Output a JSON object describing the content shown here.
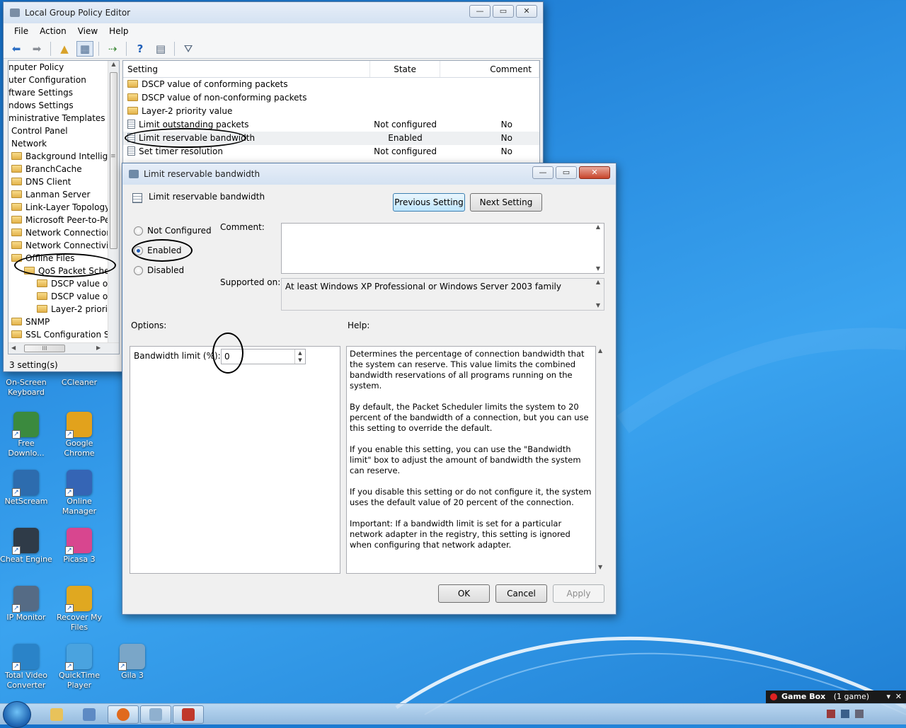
{
  "gpe": {
    "title": "Local Group Policy Editor",
    "menu": [
      "File",
      "Action",
      "View",
      "Help"
    ],
    "tree": [
      "nputer Policy",
      "uter Configuration",
      "ftware Settings",
      "ndows Settings",
      "ministrative Templates",
      "Control Panel",
      "Network",
      "Background Intelliger",
      "BranchCache",
      "DNS Client",
      "Lanman Server",
      "Link-Layer Topology",
      "Microsoft Peer-to-Pee",
      "Network Connections",
      "Network Connectivity",
      "Offline Files",
      "QoS Packet Scheduler",
      "DSCP value of cor",
      "DSCP value of nor",
      "Layer-2 priority va",
      "SNMP",
      "SSL Configuration Set"
    ],
    "columns": {
      "setting": "Setting",
      "state": "State",
      "comment": "Comment"
    },
    "rows": [
      {
        "setting": "DSCP value of conforming packets",
        "state": "",
        "comment": "",
        "kind": "folder"
      },
      {
        "setting": "DSCP value of non-conforming packets",
        "state": "",
        "comment": "",
        "kind": "folder"
      },
      {
        "setting": "Layer-2 priority value",
        "state": "",
        "comment": "",
        "kind": "folder"
      },
      {
        "setting": "Limit outstanding packets",
        "state": "Not configured",
        "comment": "No",
        "kind": "policy"
      },
      {
        "setting": "Limit reservable bandwidth",
        "state": "Enabled",
        "comment": "No",
        "kind": "policy"
      },
      {
        "setting": "Set timer resolution",
        "state": "Not configured",
        "comment": "No",
        "kind": "policy"
      }
    ],
    "status": "3 setting(s)",
    "tree_scroll_thumb": "III"
  },
  "dialog": {
    "title": "Limit reservable bandwidth",
    "heading": "Limit reservable bandwidth",
    "prev_button": "Previous Setting",
    "next_button": "Next Setting",
    "radio_not_configured": "Not Configured",
    "radio_enabled": "Enabled",
    "radio_disabled": "Disabled",
    "selected": "Enabled",
    "comment_label": "Comment:",
    "comment_value": "",
    "supported_label": "Supported on:",
    "supported_value": "At least Windows XP Professional or Windows Server 2003 family",
    "options_label": "Options:",
    "help_label": "Help:",
    "bandwidth_label": "Bandwidth limit (%):",
    "bandwidth_value": "0",
    "help_paragraphs": [
      "Determines the percentage of connection bandwidth that the system can reserve. This value limits the combined bandwidth reservations of all programs running on the system.",
      "By default, the Packet Scheduler limits the system to 20 percent of the bandwidth of a connection, but you can use this setting to override the default.",
      "If you enable this setting, you can use the \"Bandwidth limit\" box to adjust the amount of bandwidth the system can reserve.",
      "If you disable this setting or do not configure it, the system uses the default value of 20 percent of the connection.",
      "Important: If a bandwidth limit is set for a particular network adapter in the registry, this setting is ignored when configuring that network adapter."
    ],
    "ok": "OK",
    "cancel": "Cancel",
    "apply": "Apply"
  },
  "desktop_icons": [
    {
      "label": "On-Screen Keyboard",
      "icon": "keyboard-icon",
      "color": "#4a7fc0"
    },
    {
      "label": "CCleaner",
      "icon": "ccleaner-icon",
      "color": "#c0392b"
    },
    {
      "label": "Free Downlo...",
      "icon": "download-icon",
      "color": "#3b8a3e"
    },
    {
      "label": "Google Chrome",
      "icon": "chrome-icon",
      "color": "#e2a21c"
    },
    {
      "label": "NetScream",
      "icon": "netscream-icon",
      "color": "#2d6cae"
    },
    {
      "label": "Online Manager",
      "icon": "online-manager-icon",
      "color": "#3565b5"
    },
    {
      "label": "Cheat Engine",
      "icon": "cheat-engine-icon",
      "color": "#2f3b48"
    },
    {
      "label": "Picasa 3",
      "icon": "picasa-icon",
      "color": "#d8468f"
    },
    {
      "label": "IP Monitor",
      "icon": "ip-monitor-icon",
      "color": "#556b85"
    },
    {
      "label": "Recover My Files",
      "icon": "recover-icon",
      "color": "#e0a820"
    },
    {
      "label": "Total Video Converter",
      "icon": "video-converter-icon",
      "color": "#2a83c8"
    },
    {
      "label": "QuickTime Player",
      "icon": "quicktime-icon",
      "color": "#4aa3df"
    },
    {
      "label": "Gila 3",
      "icon": "image-icon",
      "color": "#7aa6c8"
    }
  ],
  "gamebox": {
    "title": "Game Box",
    "count": "(1 game)"
  }
}
